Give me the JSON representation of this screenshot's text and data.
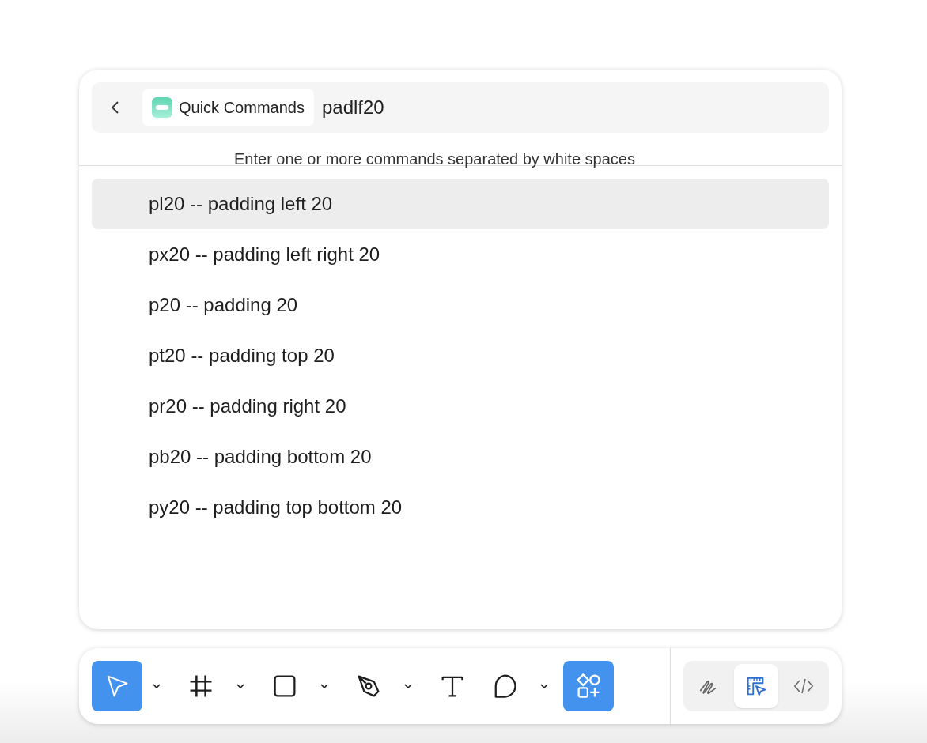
{
  "search": {
    "chip": "Quick Commands",
    "value": "padlf20",
    "hint": "Enter one or more commands separated by white spaces"
  },
  "results": [
    {
      "label": "pl20 -- padding left 20",
      "selected": true
    },
    {
      "label": "px20 -- padding left right 20",
      "selected": false
    },
    {
      "label": "p20 -- padding 20",
      "selected": false
    },
    {
      "label": "pt20 -- padding top 20",
      "selected": false
    },
    {
      "label": "pr20 -- padding right 20",
      "selected": false
    },
    {
      "label": "pb20 -- padding bottom 20",
      "selected": false
    },
    {
      "label": "py20 -- padding top bottom 20",
      "selected": false
    }
  ],
  "tools": [
    {
      "kind": "move",
      "selected": true,
      "menu": true
    },
    {
      "kind": "frame",
      "selected": false,
      "menu": true
    },
    {
      "kind": "rectangle",
      "selected": false,
      "menu": true
    },
    {
      "kind": "pen",
      "selected": false,
      "menu": true
    },
    {
      "kind": "text",
      "selected": false,
      "menu": false
    },
    {
      "kind": "bubble",
      "selected": false,
      "menu": true
    },
    {
      "kind": "actions",
      "selected": true,
      "menu": false
    }
  ],
  "modes": [
    {
      "kind": "draw",
      "selected": false
    },
    {
      "kind": "design",
      "selected": true
    },
    {
      "kind": "dev",
      "selected": false
    }
  ]
}
